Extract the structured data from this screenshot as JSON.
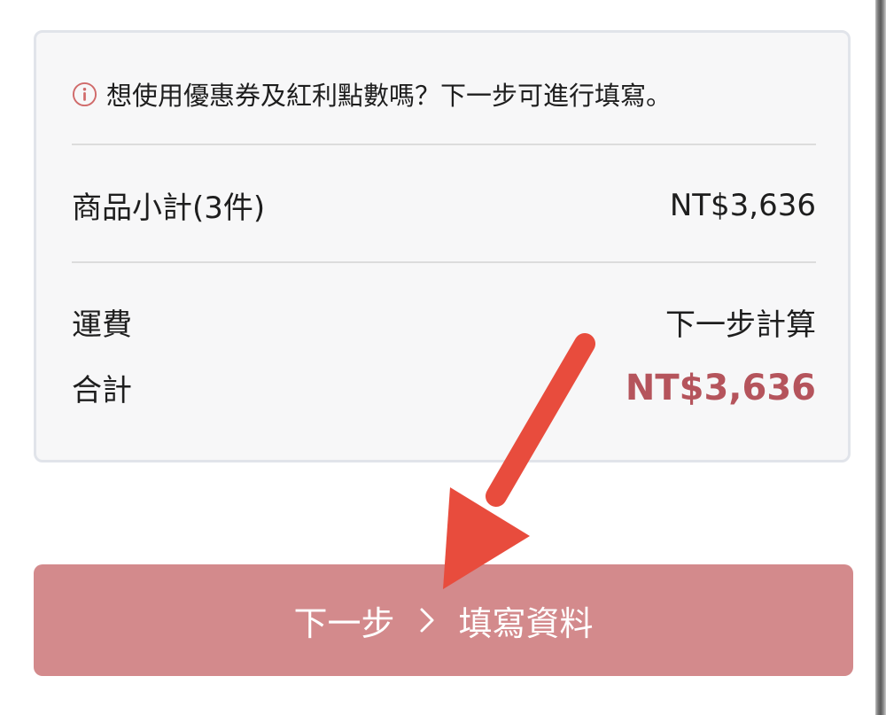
{
  "notice": {
    "icon": "info-circle-icon",
    "text": "想使用優惠券及紅利點數嗎？下一步可進行填寫。"
  },
  "summary": {
    "subtotal_label": "商品小計(3件)",
    "subtotal_value": "NT$3,636",
    "shipping_label": "運費",
    "shipping_value": "下一步計算",
    "total_label": "合計",
    "total_value": "NT$3,636"
  },
  "next_button": {
    "label_left": "下一步",
    "icon": "chevron-right-icon",
    "label_right": "填寫資料"
  },
  "colors": {
    "total_value": "#b5545c",
    "button_bg": "#d38a8c",
    "info_icon": "#d06a6a",
    "annotation_arrow": "#e84c3d"
  }
}
